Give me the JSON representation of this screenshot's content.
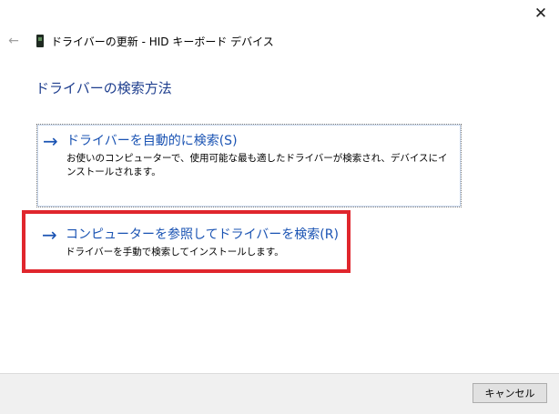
{
  "window": {
    "title": "ドライバーの更新 - HID キーボード デバイス",
    "close_glyph": "✕",
    "back_glyph": "←"
  },
  "heading": "ドライバーの検索方法",
  "options": [
    {
      "arrow": "→",
      "title": "ドライバーを自動的に検索(S)",
      "description": "お使いのコンピューターで、使用可能な最も適したドライバーが検索され、デバイスにインストールされます。"
    },
    {
      "arrow": "→",
      "title": "コンピューターを参照してドライバーを検索(R)",
      "description": "ドライバーを手動で検索してインストールします。"
    }
  ],
  "footer": {
    "cancel_label": "キャンセル"
  },
  "colors": {
    "accent_blue": "#1a53b3",
    "heading_blue": "#1e3e8e",
    "highlight_red": "#e0262d"
  },
  "icons": {
    "device": "device-icon"
  }
}
